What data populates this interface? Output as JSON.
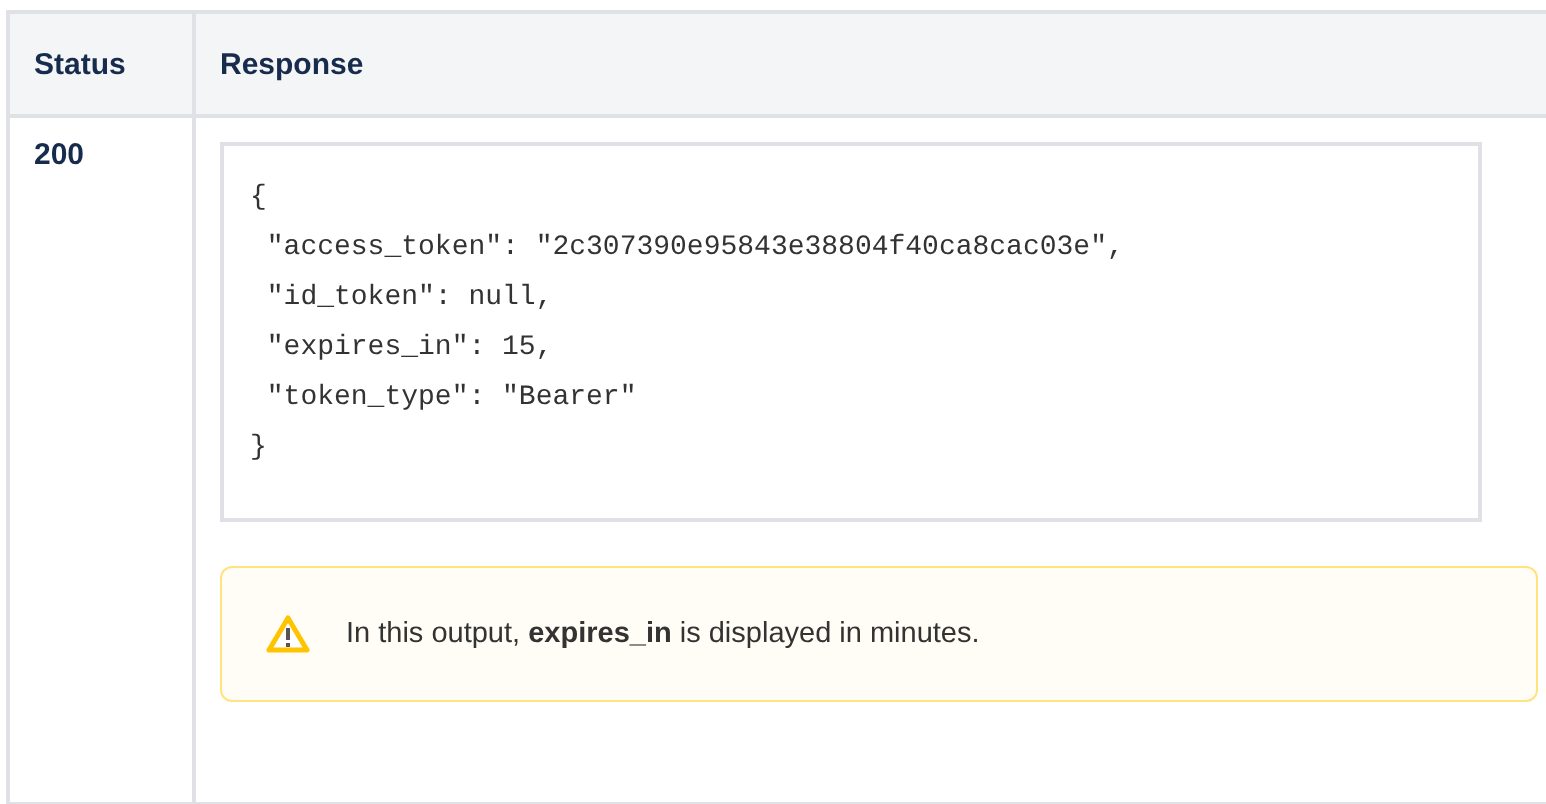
{
  "table": {
    "columns": [
      "Status",
      "Response"
    ],
    "rows": [
      {
        "status": "200",
        "code_lines": [
          "{",
          " \"access_token\": \"2c307390e95843e38804f40ca8cac03e\",",
          " \"id_token\": null,",
          " \"expires_in\": 15,",
          " \"token_type\": \"Bearer\"",
          "}"
        ],
        "note": {
          "kind": "warning",
          "text": "In this output, **expires_in** is displayed in minutes."
        }
      }
    ]
  }
}
